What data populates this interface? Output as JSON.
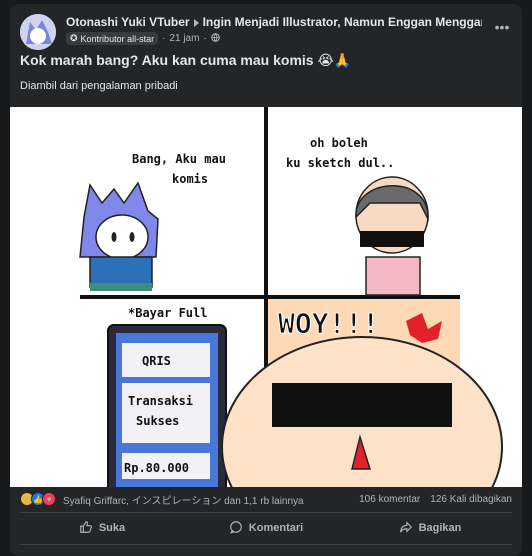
{
  "post": {
    "author": "Otonashi Yuki VTuber",
    "group": "Ingin Menjadi Illustrator, Namun Enggan Menggambar",
    "badge": "Kontributor all-star",
    "time": "21 jam",
    "title": "Kok marah bang? Aku kan cuma mau komis 😭🙏",
    "description": "Diambil dari pengalaman pribadi"
  },
  "comic": {
    "panel1_text_line1": "Bang, Aku mau",
    "panel1_text_line2": "komis",
    "panel2_text_line1": "oh boleh",
    "panel2_text_line2": "ku sketch dul..",
    "panel3_text": "*Bayar Full",
    "qris_label": "QRIS",
    "transaksi_line1": "Transaksi",
    "transaksi_line2": "Sukses",
    "amount": "Rp.80.000",
    "panel4_text": "WOY!!!"
  },
  "stats": {
    "reactors": "Syafiq Griffarc, インスピレーション dan 1,1 rb lainnya",
    "comments": "106 komentar",
    "shares": "126 Kali dibagikan"
  },
  "actions": {
    "like": "Suka",
    "comment": "Komentari",
    "share": "Bagikan"
  },
  "icons": [
    "avatar",
    "star-badge-icon",
    "globe-icon",
    "more-icon",
    "like-icon",
    "comment-icon",
    "share-icon"
  ],
  "colors": {
    "background": "#18191a",
    "card": "#242526",
    "text": "#e4e6eb",
    "muted": "#b0b3b8"
  }
}
